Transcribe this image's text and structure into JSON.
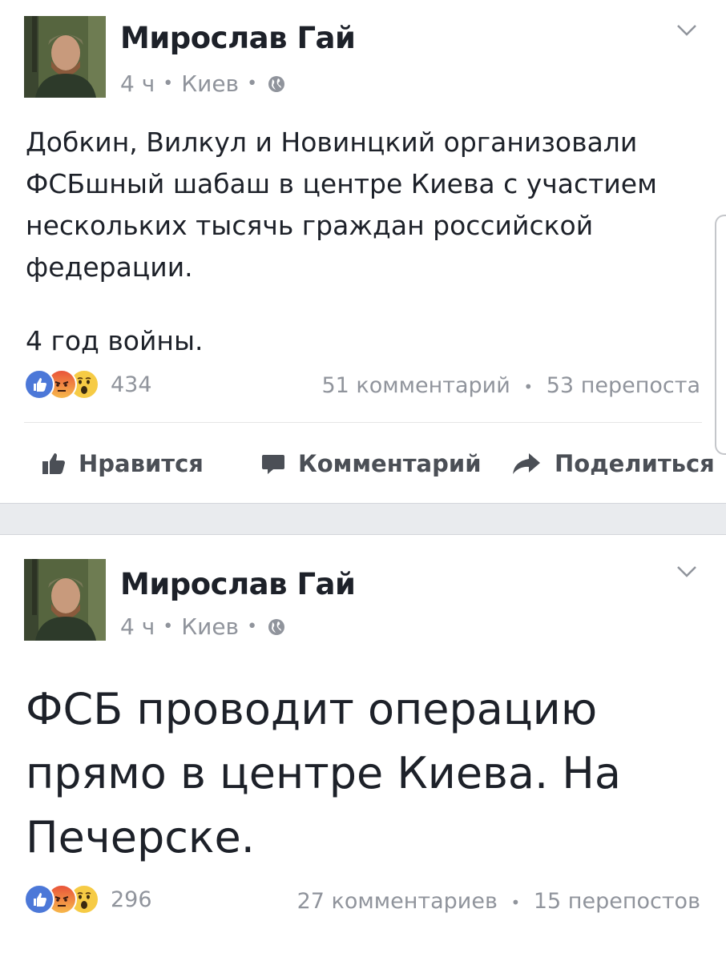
{
  "posts": [
    {
      "author": "Мирослав Гай",
      "time": "4 ч",
      "location": "Киев",
      "privacy_icon": "globe-icon",
      "text": "Добкин, Вилкул и Новинцкий организовали\nФСБшный шабаш в центре Киева с участием\nнескольких тысячь граждан российской\nфедерации.",
      "text_extra": "4 год войны.",
      "reactions": [
        "like",
        "angry",
        "wow"
      ],
      "reaction_count": "434",
      "comments": "51 комментарий",
      "shares": "53 перепоста"
    },
    {
      "author": "Мирослав Гай",
      "time": "4 ч",
      "location": "Киев",
      "privacy_icon": "globe-icon",
      "text": "ФСБ проводит операцию\nпрямо в центре Киева. На\nПечерске.",
      "reactions": [
        "like",
        "angry",
        "wow"
      ],
      "reaction_count": "296",
      "comments": "27 комментариев",
      "shares": "15 перепостов"
    }
  ],
  "actions": {
    "like": "Нравится",
    "comment": "Комментарий",
    "share": "Поделиться"
  },
  "separator": "•",
  "colors": {
    "like_blue": "#4c78d8",
    "meta_gray": "#90949c",
    "text": "#1d2129",
    "divider": "#e9ebee"
  }
}
